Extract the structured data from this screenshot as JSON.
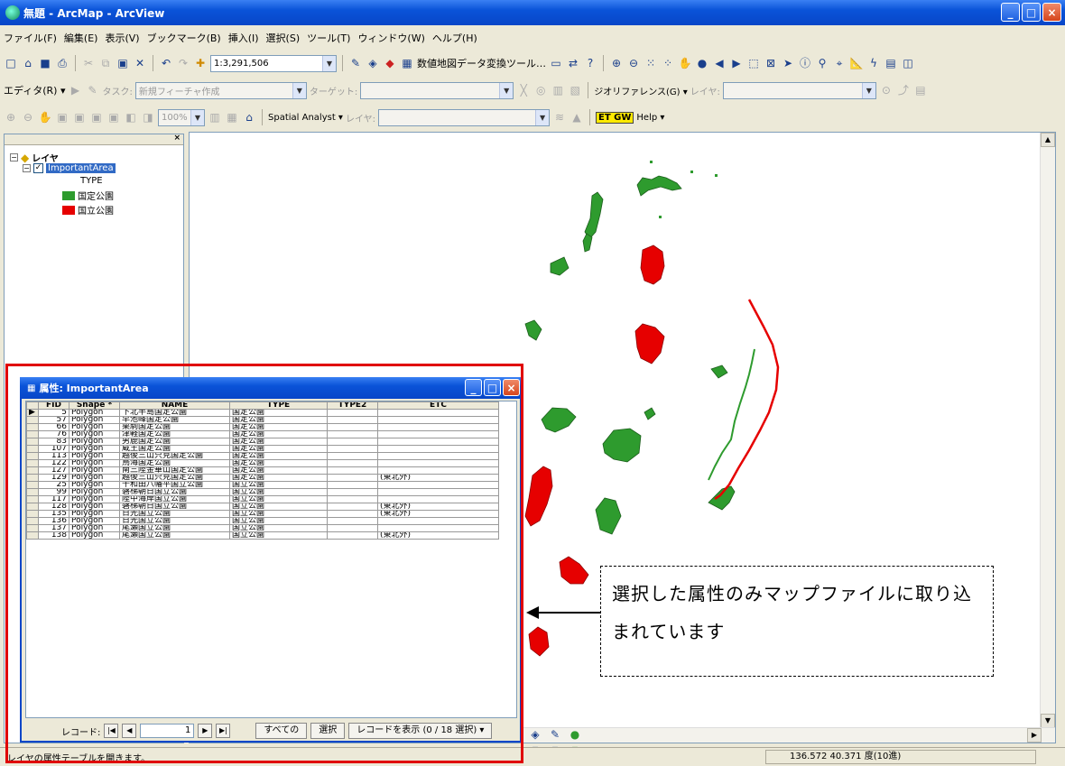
{
  "window": {
    "title": "無題 - ArcMap - ArcView"
  },
  "menu": [
    "ファイル(F)",
    "編集(E)",
    "表示(V)",
    "ブックマーク(B)",
    "挿入(I)",
    "選択(S)",
    "ツール(T)",
    "ウィンドウ(W)",
    "ヘルプ(H)"
  ],
  "toolbar1": {
    "scale": "1:3,291,506",
    "conv_tool": "数値地図データ変換ツール…"
  },
  "toolbar2": {
    "editor": "エディタ(R) ▾",
    "task_label": "タスク:",
    "task_value": "新規フィーチャ作成",
    "target_label": "ターゲット:",
    "georef": "ジオリファレンス(G) ▾",
    "layer_label": "レイヤ:"
  },
  "toolbar3": {
    "zoom": "100%",
    "spatial_analyst": "Spatial Analyst ▾",
    "layer_label": "レイヤ:",
    "etgw": "ET GW",
    "help": "Help ▾"
  },
  "toc": {
    "root": "レイヤ",
    "layer": "ImportantArea",
    "field": "TYPE",
    "legend": [
      {
        "label": "国定公園",
        "color": "#2e9b2e"
      },
      {
        "label": "国立公園",
        "color": "#e60000"
      }
    ]
  },
  "attr": {
    "title": "属性: ImportantArea",
    "columns": [
      "FID",
      "Shape *",
      "NAME",
      "TYPE",
      "TYPE2",
      "ETC"
    ],
    "rows": [
      [
        "5",
        "Polygon",
        "下北半島国定公園",
        "国定公園",
        "",
        ""
      ],
      [
        "57",
        "Polygon",
        "早池峰国定公園",
        "国定公園",
        "",
        ""
      ],
      [
        "66",
        "Polygon",
        "栗駒国定公園",
        "国定公園",
        "",
        ""
      ],
      [
        "76",
        "Polygon",
        "津軽国定公園",
        "国定公園",
        "",
        ""
      ],
      [
        "83",
        "Polygon",
        "男鹿国定公園",
        "国定公園",
        "",
        ""
      ],
      [
        "107",
        "Polygon",
        "蔵王国定公園",
        "国定公園",
        "",
        ""
      ],
      [
        "113",
        "Polygon",
        "越後三山只見国定公園",
        "国定公園",
        "",
        ""
      ],
      [
        "122",
        "Polygon",
        "鳥海国定公園",
        "国定公園",
        "",
        ""
      ],
      [
        "127",
        "Polygon",
        "南三陸金華山国定公園",
        "国定公園",
        "",
        ""
      ],
      [
        "129",
        "Polygon",
        "越後三山只見国定公園",
        "国定公園",
        "",
        "(東北外)"
      ],
      [
        "25",
        "Polygon",
        "十和田八幡平国立公園",
        "国立公園",
        "",
        ""
      ],
      [
        "99",
        "Polygon",
        "磐梯朝日国立公園",
        "国立公園",
        "",
        ""
      ],
      [
        "117",
        "Polygon",
        "陸中海岸国立公園",
        "国立公園",
        "",
        ""
      ],
      [
        "128",
        "Polygon",
        "磐梯朝日国立公園",
        "国立公園",
        "",
        "(東北外)"
      ],
      [
        "135",
        "Polygon",
        "日光国立公園",
        "国立公園",
        "",
        "(東北外)"
      ],
      [
        "136",
        "Polygon",
        "日光国立公園",
        "国立公園",
        "",
        ""
      ],
      [
        "137",
        "Polygon",
        "尾瀬国立公園",
        "国立公園",
        "",
        ""
      ],
      [
        "138",
        "Polygon",
        "尾瀬国立公園",
        "国立公園",
        "",
        "(東北外)"
      ]
    ],
    "record_label": "レコード:",
    "record_value": "1",
    "btn_all": "すべての",
    "btn_selected": "選択",
    "record_status": "レコードを表示 (0 / 18 選択) ▾"
  },
  "callout": {
    "text": "選択した属性のみマップファイルに取り込まれています"
  },
  "status": {
    "message": "レイヤの属性テーブルを開きます。",
    "coords": "136.572  40.371 度(10進)"
  },
  "colors": {
    "national_park": "#e60000",
    "quasi_national_park": "#2e9b2e",
    "highlight": "#e00000"
  }
}
